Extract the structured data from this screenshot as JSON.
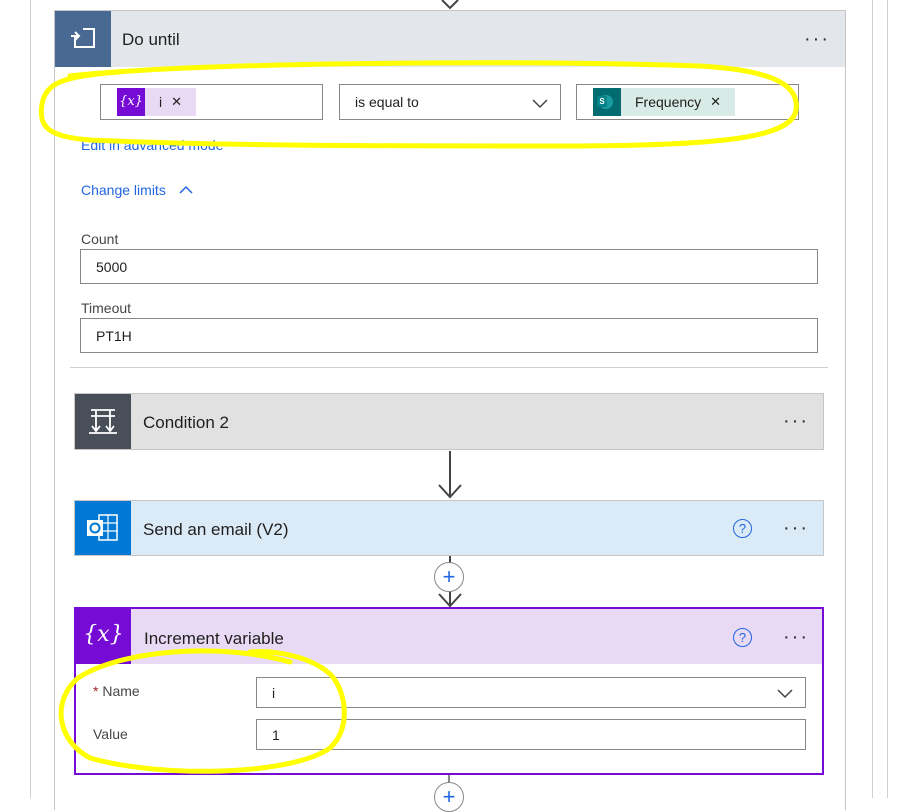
{
  "do_until": {
    "title": "Do until",
    "condition": {
      "left_token": "i",
      "left_token_icon": "{x}",
      "operator": "is equal to",
      "right_token": "Frequency",
      "right_token_icon": "S"
    },
    "advanced_link": "Edit in advanced mode",
    "change_limits": "Change limits",
    "count_label": "Count",
    "count_value": "5000",
    "timeout_label": "Timeout",
    "timeout_value": "PT1H"
  },
  "condition2": {
    "title": "Condition 2"
  },
  "send_email": {
    "title": "Send an email (V2)"
  },
  "increment": {
    "title": "Increment variable",
    "icon": "{x}",
    "name_label": "Name",
    "name_required": "*",
    "name_value": "i",
    "value_label": "Value",
    "value_value": "1"
  },
  "common": {
    "more": "···",
    "help": "?",
    "plus": "+"
  },
  "colors": {
    "do_until_header": "#e3e7ec",
    "do_until_icon_bg": "#486991",
    "condition_header": "#e1e1e1",
    "condition_icon_bg": "#484f58",
    "email_header": "#dbeaf7",
    "email_icon_bg": "#0078d4",
    "variable_header": "#e8daf4",
    "variable_icon_bg": "#770bd6",
    "link": "#2266e3",
    "highlight": "#ffff00"
  }
}
